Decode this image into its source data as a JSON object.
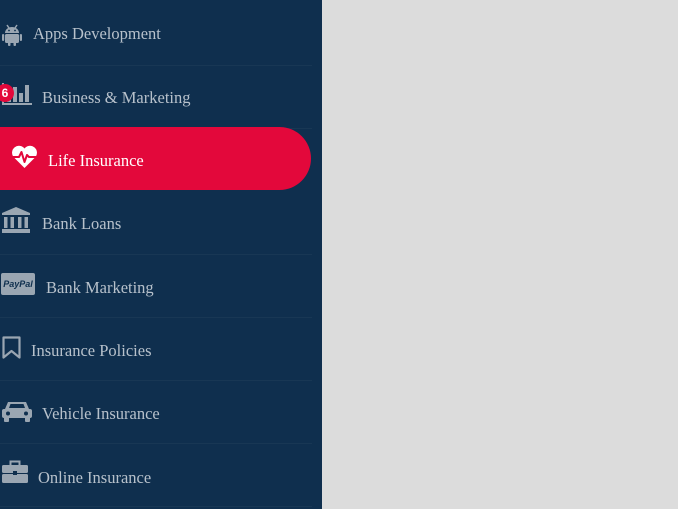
{
  "sidebar": {
    "items": [
      {
        "label": "Apps Development",
        "icon": "android-icon"
      },
      {
        "label": "Business & Marketing",
        "icon": "bar-chart-icon",
        "badge": "6"
      },
      {
        "label": "Life Insurance",
        "icon": "heartbeat-icon",
        "active": true
      },
      {
        "label": "Bank Loans",
        "icon": "bank-icon"
      },
      {
        "label": "Bank Marketing",
        "icon": "paypal-icon",
        "icon_text": "PayPal"
      },
      {
        "label": "Insurance Policies",
        "icon": "bookmark-icon"
      },
      {
        "label": "Vehicle Insurance",
        "icon": "car-icon"
      },
      {
        "label": "Online Insurance",
        "icon": "briefcase-icon"
      }
    ]
  },
  "colors": {
    "sidebar_bg": "#0f2f4e",
    "active_bg": "#e3083b",
    "text": "#b7c1cb",
    "main_bg": "#dcdcdc"
  }
}
